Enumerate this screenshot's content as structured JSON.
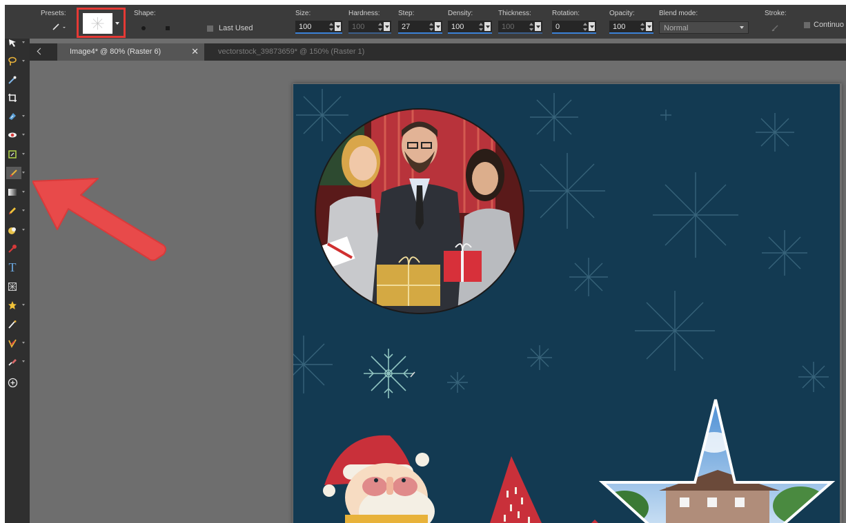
{
  "toolbar": {
    "presets_label": "Presets:",
    "shape_label": "Shape:",
    "last_used_label": "Last Used",
    "size": {
      "label": "Size:",
      "value": "100"
    },
    "hardness": {
      "label": "Hardness:",
      "value": "100"
    },
    "step": {
      "label": "Step:",
      "value": "27"
    },
    "density": {
      "label": "Density:",
      "value": "100"
    },
    "thickness": {
      "label": "Thickness:",
      "value": "100"
    },
    "rotation": {
      "label": "Rotation:",
      "value": "0"
    },
    "opacity": {
      "label": "Opacity:",
      "value": "100"
    },
    "blend_mode": {
      "label": "Blend mode:",
      "value": "Normal"
    },
    "stroke_label": "Stroke:",
    "continuous_label": "Continuo"
  },
  "tabs": [
    {
      "label": "Image4* @  80% (Raster 6)",
      "active": true
    },
    {
      "label": "vectorstock_39873659* @ 150% (Raster 1)",
      "active": false
    }
  ],
  "tools": [
    "pan-icon",
    "pick-icon",
    "selection-icon",
    "dropper-icon",
    "crop-icon",
    "move-icon",
    "red-eye-icon",
    "straighten-icon",
    "paint-brush-icon",
    "gradient-icon",
    "pencil-icon",
    "dodge-icon",
    "color-changer-icon",
    "text-icon",
    "warp-icon",
    "star-shape-icon",
    "smudge-icon",
    "picture-tube-icon",
    "eraser-icon",
    "add-tool-icon"
  ],
  "colors": {
    "canvas_bg": "#133a52",
    "highlight": "#e53935",
    "accent_blue": "#3b82d9"
  }
}
